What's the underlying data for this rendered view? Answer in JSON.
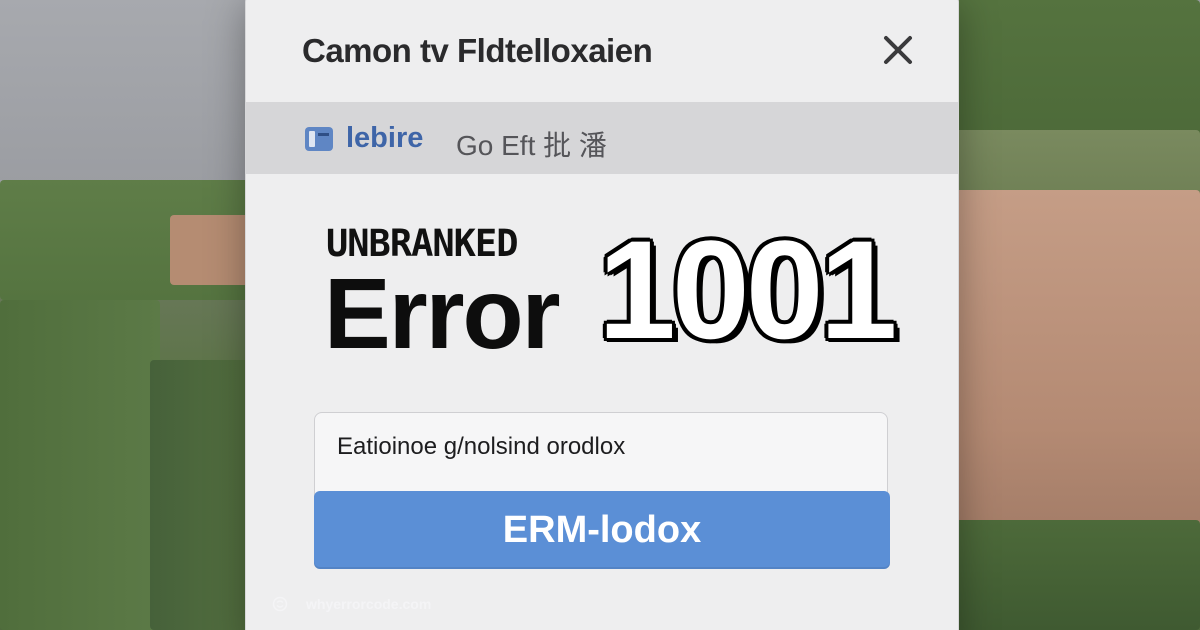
{
  "dialog": {
    "title": "Camon tv Fldtelloxaien",
    "close_icon": "close-icon"
  },
  "source_bar": {
    "icon": "folder-tab-icon",
    "brand": "lebire",
    "text": "Go Eft 批 潘"
  },
  "error": {
    "label": "UNBRANKED",
    "word": "Error",
    "code": "1001"
  },
  "input": {
    "value": "Eatioinoe g/nolsind orodlox"
  },
  "button": {
    "label": "ERM-lodox"
  },
  "watermark": {
    "text": "whyerrorcode.com"
  },
  "colors": {
    "accent": "#5b8fd6",
    "brand": "#3e65a8",
    "dialog_bg": "#eeeeef",
    "source_bar_bg": "#d6d6d8"
  }
}
